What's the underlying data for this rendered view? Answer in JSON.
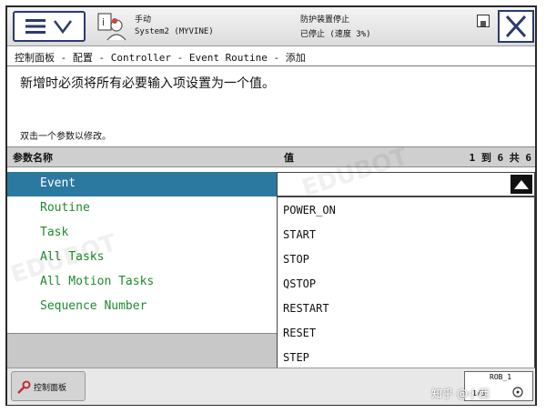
{
  "status": {
    "mode": "手动",
    "system": "System2 (MYVINE)",
    "safety": "防护装置停止",
    "state": "已停止 (速度 3%)"
  },
  "breadcrumb": "控制面板 - 配置 - Controller - Event Routine - 添加",
  "instruction": "新增时必须将所有必要输入项设置为一个值。",
  "hint": "双击一个参数以修改。",
  "table": {
    "col_name": "参数名称",
    "col_value": "值",
    "pager": "1 到 6 共 6",
    "params": [
      "Event",
      "Routine",
      "Task",
      "All Tasks",
      "All Motion Tasks",
      "Sequence Number"
    ]
  },
  "dropdown": {
    "options": [
      "POWER_ON",
      "START",
      "STOP",
      "QSTOP",
      "RESTART",
      "RESET",
      "STEP"
    ]
  },
  "taskbar": {
    "control_panel": "控制面板",
    "rob": "ROB_1",
    "rob_sub": "1/3"
  },
  "watermark": {
    "brand": "EDUBOT",
    "cn": "知乎 @小西"
  },
  "colors": {
    "selected_row": "#2b79a0",
    "param_text": "#1f8a2e",
    "pager": "#3b4cc4"
  }
}
